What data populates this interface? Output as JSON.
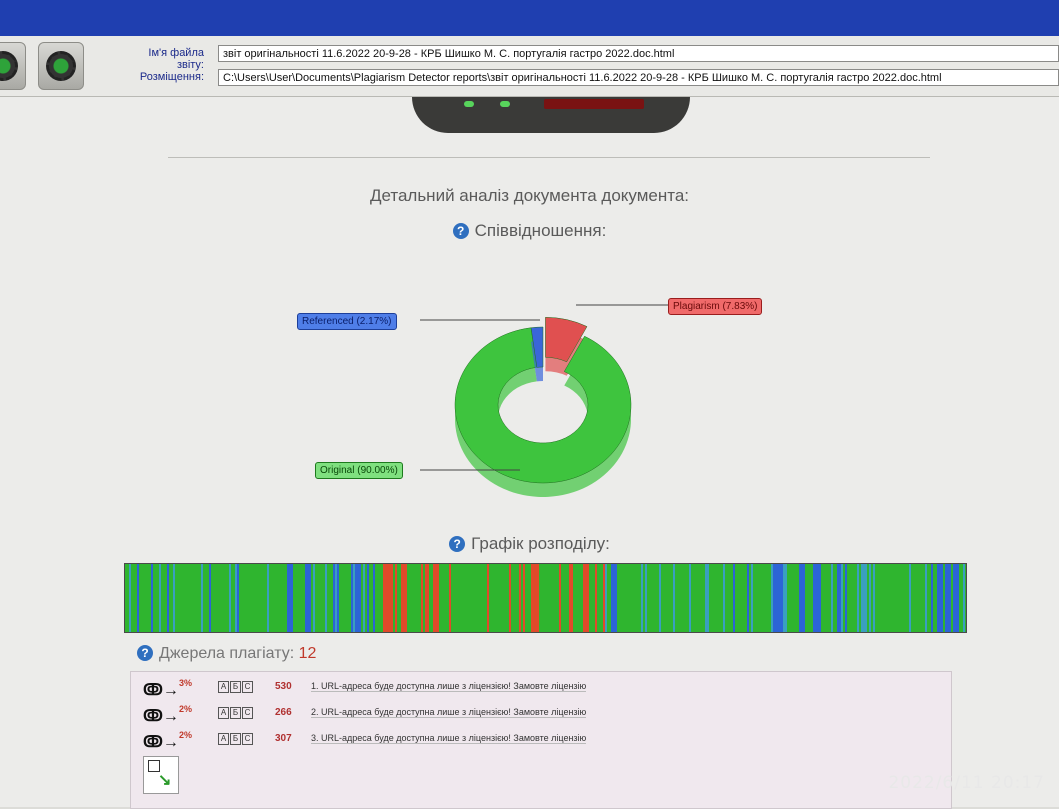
{
  "toolbar": {
    "file_name_label": "Ім'я файла звіту:",
    "file_name_value": "звіт оригінальності 11.6.2022 20-9-28 - КРБ Шишко М. С. португалія гастро 2022.doc.html",
    "location_label": "Розміщення:",
    "location_value": "C:\\Users\\User\\Documents\\Plagiarism Detector reports\\звіт оригінальності 11.6.2022 20-9-28 - КРБ Шишко М. С. португалія гастро 2022.doc.html"
  },
  "analysis": {
    "title": "Детальний аналіз документа документа:",
    "ratio_heading": "Співвідношення:",
    "distribution_heading": "Графік розподілу:",
    "sources_heading": "Джерела плагіату:",
    "sources_count": "12"
  },
  "chart_data": {
    "type": "pie",
    "categories": [
      "Original (90.00%)",
      "Referenced (2.17%)",
      "Plagiarism (7.83%)"
    ],
    "values": [
      90.0,
      2.17,
      7.83
    ],
    "colors": [
      "#3ec43e",
      "#3a66d8",
      "#e05050"
    ]
  },
  "distribution": {
    "base_color": "#2fb52f",
    "segment_colors": {
      "blue": "#2c64d6",
      "red": "#e04a2a",
      "teal": "#3a9fbf"
    }
  },
  "sources": [
    {
      "percent": "3%",
      "count": "530",
      "text": "1. URL-адреса буде доступна лише з ліцензією! Замовте ліцензію"
    },
    {
      "percent": "2%",
      "count": "266",
      "text": "2. URL-адреса буде доступна лише з ліцензією! Замовте ліцензію"
    },
    {
      "percent": "2%",
      "count": "307",
      "text": "3. URL-адреса буде доступна лише з ліцензією! Замовте ліцензію"
    }
  ],
  "abc_letters": [
    "A",
    "Б",
    "C"
  ],
  "timestamp": "2022/6/11 20:17",
  "icons": [
    "toolbar-button-icon",
    "settings-gear-icon",
    "help-icon",
    "link-chain-icon",
    "arrow-right-icon",
    "expand-icon"
  ]
}
